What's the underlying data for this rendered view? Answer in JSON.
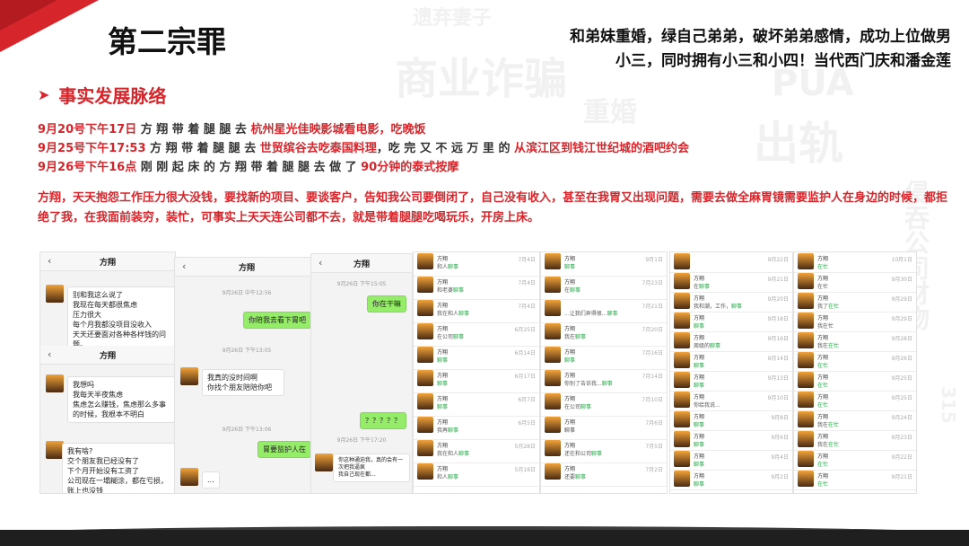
{
  "slide": {
    "title": "第二宗罪",
    "subtitle_line1": "和弟妹重婚，绿自己弟弟，破坏弟弟感情，成功上位做男",
    "subtitle_line2": "小三，同时拥有小三和小四！当代西门庆和潘金莲",
    "section_heading": "事实发展脉络",
    "timeline": [
      {
        "date": "9月20号下午17日",
        "pre": " 方 翔 带 着 腿 腿 去 ",
        "hl": "杭州星光佳映影城看电影，吃晚饭",
        "mid": "",
        "hl2": ""
      },
      {
        "date": "9月25号下午17:53",
        "pre": " 方 翔 带 着 腿 腿 去 ",
        "hl": "世贸缤谷去吃泰国料理",
        "mid": "，吃 完 又 不 远 万 里 的 ",
        "hl2": "从滨江区到钱江世纪城的酒吧约会"
      },
      {
        "date": "9月26号下午16点",
        "pre": " 刚 刚 起 床 的 方 翔 带 着 腿 腿 去 做 了 ",
        "hl": "90分钟的泰式按摩",
        "mid": "",
        "hl2": ""
      }
    ],
    "paragraph": "方翔，天天抱怨工作压力很大没钱，要找新的项目、要谈客户，告知我公司要倒闭了，自己没有收入，甚至在我胃又出现问题，需要去做全麻胃镜需要监护人在身边的时候，都拒绝了我，在我面前装穷，装忙，可事实上天天连公司都不去，就是带着腿腿吃喝玩乐，开房上床。"
  },
  "background_words": [
    "商业诈骗",
    "遗弃妻子",
    "PUA",
    "出轨",
    "侵吞公司财物",
    "重婚",
    "315"
  ],
  "chat1": {
    "name": "方翔",
    "msg1": "别和我这么说了\n我现在每天都很焦虑\n压力很大\n每个月我都没项目没收入\n天天还要面对各种各样钱的问题。",
    "name2": "方翔",
    "msg2": "我想吗\n我每天半夜焦虑\n焦虑怎么赚钱，焦虑那么多事的时候，我根本不明白",
    "msg3": "我有啥?\n交个朋友我已经没有了\n下个月开始没有工资了\n公司现在一塌糊涂，都在亏损，账上也没钱"
  },
  "chat2": {
    "name": "方翔",
    "ts1": "9月26日 中午12:56",
    "g1": "你陪我去看下胃吧",
    "ts2": "9月26日 下午13:05",
    "msg1": "我真的没时间啊\n你找个朋友陪陪你吧",
    "ts3": "9月26日 下午13:06",
    "g2": "？？？？？",
    "g3": "胃要监护人在",
    "msg2": "..."
  },
  "chat3": {
    "name": "方翔",
    "ts1": "9月26日 下午15:05",
    "g1": "你在干嘛",
    "ts2": "9月26日 下午17:20",
    "msg1": "你这种通迫我，真的会有一次把我逼疯\n我自己现在都...",
    "msg2": ""
  },
  "list_a": [
    {
      "n": "方翔",
      "t": "和人",
      "k": "聊事",
      "d": "7月4日"
    },
    {
      "n": "方翔",
      "t": "和老婆",
      "k": "聊事",
      "d": "7月4日"
    },
    {
      "n": "方翔",
      "t": "我在和人",
      "k": "聊事",
      "d": "7月4日"
    },
    {
      "n": "方翔",
      "t": "在公司",
      "k": "聊事",
      "d": "6月25日"
    },
    {
      "n": "方翔",
      "t": "",
      "k": "聊事",
      "d": "6月14日"
    },
    {
      "n": "方翔",
      "t": "",
      "k": "聊事",
      "d": "6月17日"
    },
    {
      "n": "方翔",
      "t": "",
      "k": "聊事",
      "d": "6月7日"
    },
    {
      "n": "方翔",
      "t": "我再",
      "k": "聊事",
      "d": "6月5日"
    },
    {
      "n": "方翔",
      "t": "我在和人",
      "k": "聊事",
      "d": "5月28日"
    },
    {
      "n": "方翔",
      "t": "和人",
      "k": "聊事",
      "d": "5月18日"
    }
  ],
  "list_b": [
    {
      "n": "方翔",
      "t": "",
      "k": "聊事",
      "d": "9月1日"
    },
    {
      "n": "方翔",
      "t": "在",
      "k": "聊事",
      "d": "7月23日"
    },
    {
      "n": "",
      "t": "...让我们弄得很...",
      "k": "聊事",
      "d": "7月21日"
    },
    {
      "n": "方翔",
      "t": "我在",
      "k": "聊事",
      "d": "7月20日"
    },
    {
      "n": "方翔",
      "t": "",
      "k": "聊事",
      "d": "7月16日"
    },
    {
      "n": "方翔",
      "t": "你别了告诉我...",
      "k": "聊事",
      "d": "7月14日"
    },
    {
      "n": "方翔",
      "t": "在公司",
      "k": "聊事",
      "d": "7月10日"
    },
    {
      "n": "方翔",
      "t": "聊事",
      "k": "",
      "d": "7月6日"
    },
    {
      "n": "方翔",
      "t": "还在和公司",
      "k": "聊事",
      "d": "7月5日"
    },
    {
      "n": "方翔",
      "t": "还要",
      "k": "聊事",
      "d": "7月2日"
    }
  ],
  "list_c": [
    {
      "n": "",
      "t": "",
      "k": "",
      "d": "9月22日"
    },
    {
      "n": "方翔",
      "t": "在",
      "k": "聊事",
      "d": "9月21日"
    },
    {
      "n": "方翔",
      "t": "我和潮，工作，",
      "k": "聊事",
      "d": "9月20日"
    },
    {
      "n": "方翔",
      "t": "",
      "k": "聊事",
      "d": "9月18日"
    },
    {
      "n": "方翔",
      "t": "周级的",
      "k": "聊事",
      "d": "9月16日"
    },
    {
      "n": "方翔",
      "t": "",
      "k": "聊事",
      "d": "9月14日"
    },
    {
      "n": "方翔",
      "t": "",
      "k": "聊事",
      "d": "9月13日"
    },
    {
      "n": "方翔",
      "t": "你给我说...",
      "k": "",
      "d": "9月10日"
    },
    {
      "n": "方翔",
      "t": "",
      "k": "聊事",
      "d": "9月8日"
    },
    {
      "n": "方翔",
      "t": "",
      "k": "聊事",
      "d": "9月6日"
    },
    {
      "n": "方翔",
      "t": "",
      "k": "聊事",
      "d": "9月4日"
    },
    {
      "n": "方翔",
      "t": "",
      "k": "聊事",
      "d": "9月2日"
    }
  ],
  "list_d": [
    {
      "n": "方翔",
      "t": "",
      "k": "在忙",
      "d": "10月1日"
    },
    {
      "n": "方翔",
      "t": "在忙",
      "k": "",
      "d": "9月30日"
    },
    {
      "n": "方翔",
      "t": "我了",
      "k": "在忙",
      "d": "9月29日"
    },
    {
      "n": "方翔",
      "t": "我在忙",
      "k": "",
      "d": "9月29日"
    },
    {
      "n": "方翔",
      "t": "我在",
      "k": "在忙",
      "d": "9月28日"
    },
    {
      "n": "方翔",
      "t": "",
      "k": "在忙",
      "d": "9月26日"
    },
    {
      "n": "方翔",
      "t": "",
      "k": "在忙",
      "d": "9月25日"
    },
    {
      "n": "方翔",
      "t": "",
      "k": "在忙",
      "d": "9月25日"
    },
    {
      "n": "方翔",
      "t": "我在",
      "k": "在忙",
      "d": "9月24日"
    },
    {
      "n": "方翔",
      "t": "我在",
      "k": "在忙",
      "d": "9月23日"
    },
    {
      "n": "方翔",
      "t": "",
      "k": "在忙",
      "d": "9月22日"
    },
    {
      "n": "方翔",
      "t": "",
      "k": "在忙",
      "d": "9月21日"
    }
  ]
}
